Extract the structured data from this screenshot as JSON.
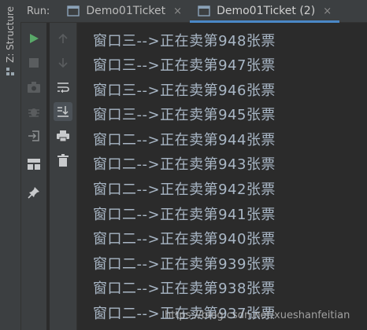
{
  "side_panel": {
    "label": "Z: Structure"
  },
  "tabbar": {
    "run_label": "Run:",
    "tabs": [
      {
        "label": "Demo01Ticket",
        "close": "×"
      },
      {
        "label": "Demo01Ticket (2)",
        "close": "×"
      }
    ]
  },
  "toolbar_left": [
    "run-icon",
    "stop-icon",
    "camera-icon",
    "debug-bug-icon",
    "login-icon",
    "layout-icon",
    "pin-icon"
  ],
  "toolbar_right": [
    "up-arrow-icon",
    "down-arrow-icon",
    "soft-wrap-icon",
    "scroll-to-end-icon",
    "print-icon",
    "trash-icon"
  ],
  "colors": {
    "run_green": "#59a869",
    "accent": "#4a88c7",
    "text": "#a9b7c6"
  },
  "console": {
    "lines": [
      "窗口三-->正在卖第948张票",
      "窗口三-->正在卖第947张票",
      "窗口三-->正在卖第946张票",
      "窗口三-->正在卖第945张票",
      "窗口二-->正在卖第944张票",
      "窗口二-->正在卖第943张票",
      "窗口二-->正在卖第942张票",
      "窗口二-->正在卖第941张票",
      "窗口二-->正在卖第940张票",
      "窗口二-->正在卖第939张票",
      "窗口二-->正在卖第938张票",
      "窗口二-->正在卖第937张票"
    ]
  },
  "watermark": "https://blog.csdn.net/xueshanfeitian"
}
